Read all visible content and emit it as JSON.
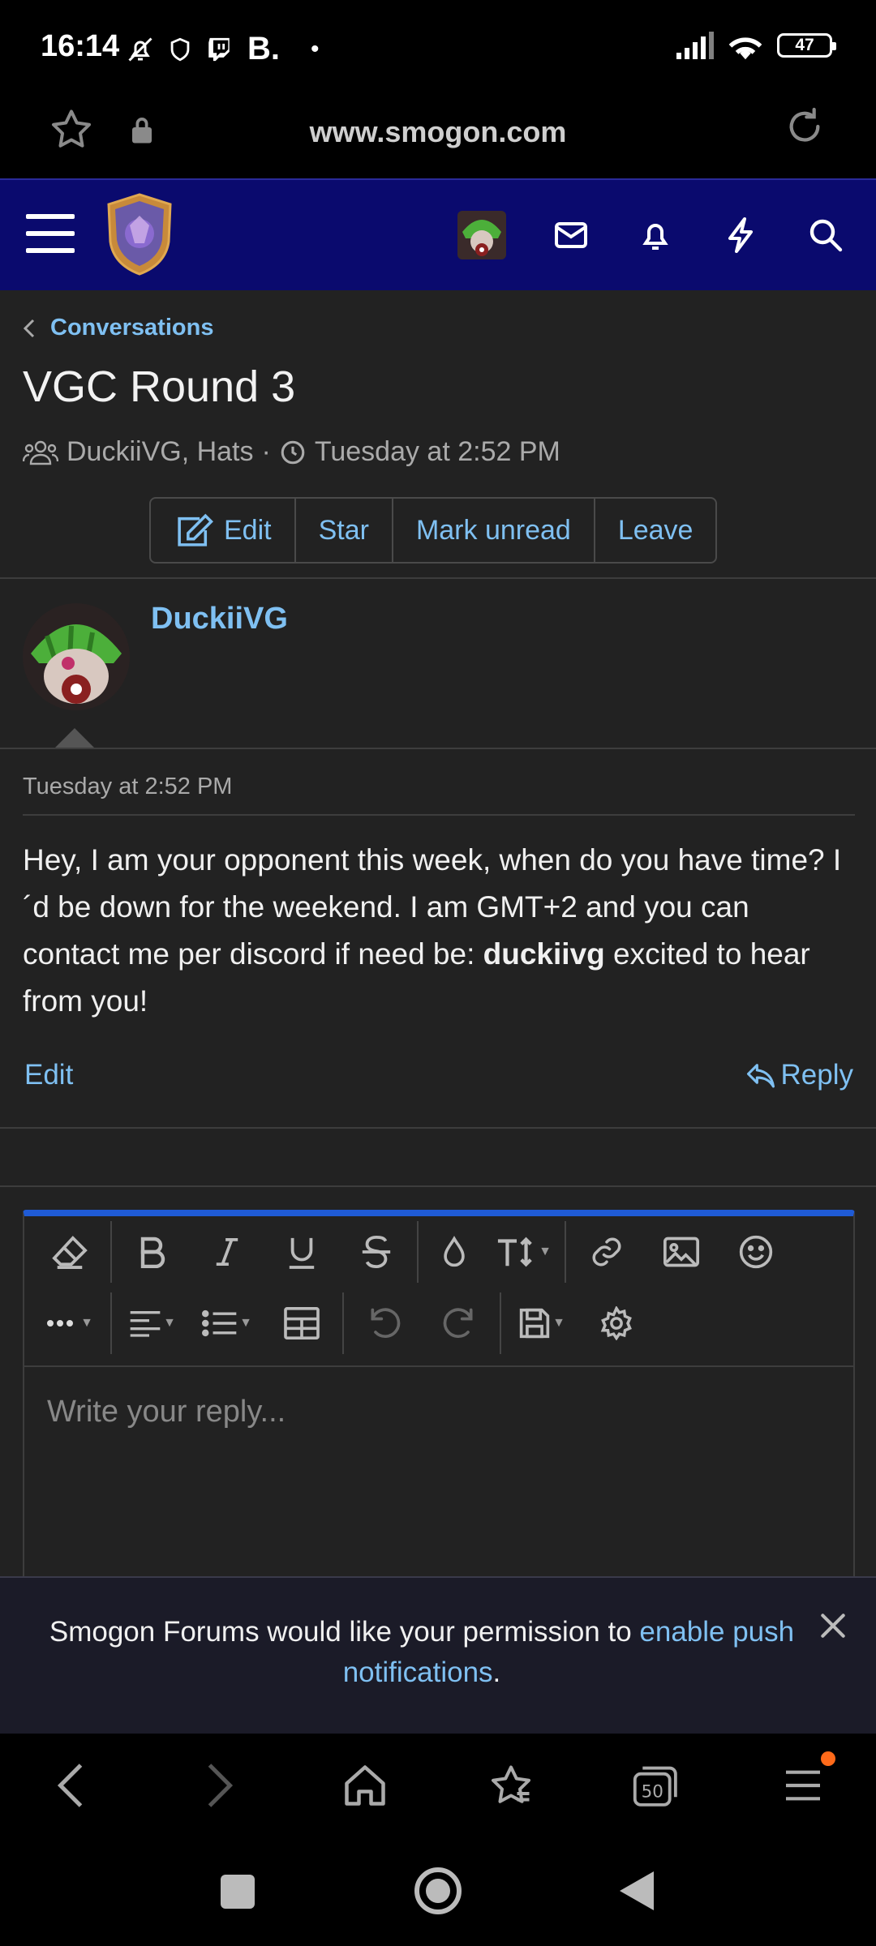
{
  "status_bar": {
    "time": "16:14",
    "extra_icon_text": "B.",
    "dot": "•",
    "battery": "47"
  },
  "browser": {
    "url": "www.smogon.com"
  },
  "breadcrumb": {
    "label": "Conversations"
  },
  "conversation": {
    "title": "VGC Round 3",
    "participants": "DuckiiVG, Hats",
    "separator": "·",
    "timestamp": "Tuesday at 2:52 PM"
  },
  "actions": {
    "edit": "Edit",
    "star": "Star",
    "mark_unread": "Mark unread",
    "leave": "Leave"
  },
  "message": {
    "author": "DuckiiVG",
    "date": "Tuesday at 2:52 PM",
    "body_part1": "Hey, I am your opponent this week, when do you have time? I´d be down for the weekend. I am GMT+2 and you can contact me per discord if need be: ",
    "body_bold": "duckiivg",
    "body_part2": " excited to hear from you!",
    "edit_label": "Edit",
    "reply_label": "Reply"
  },
  "editor": {
    "placeholder": "Write your reply..."
  },
  "notification": {
    "text": "Smogon Forums would like your permission to ",
    "link": "enable push notifications",
    "end": "."
  },
  "colors": {
    "header_bg": "#0a0a6e",
    "link": "#7fc0f2",
    "page_bg": "#222222",
    "editor_accent": "#1f5bd6"
  }
}
